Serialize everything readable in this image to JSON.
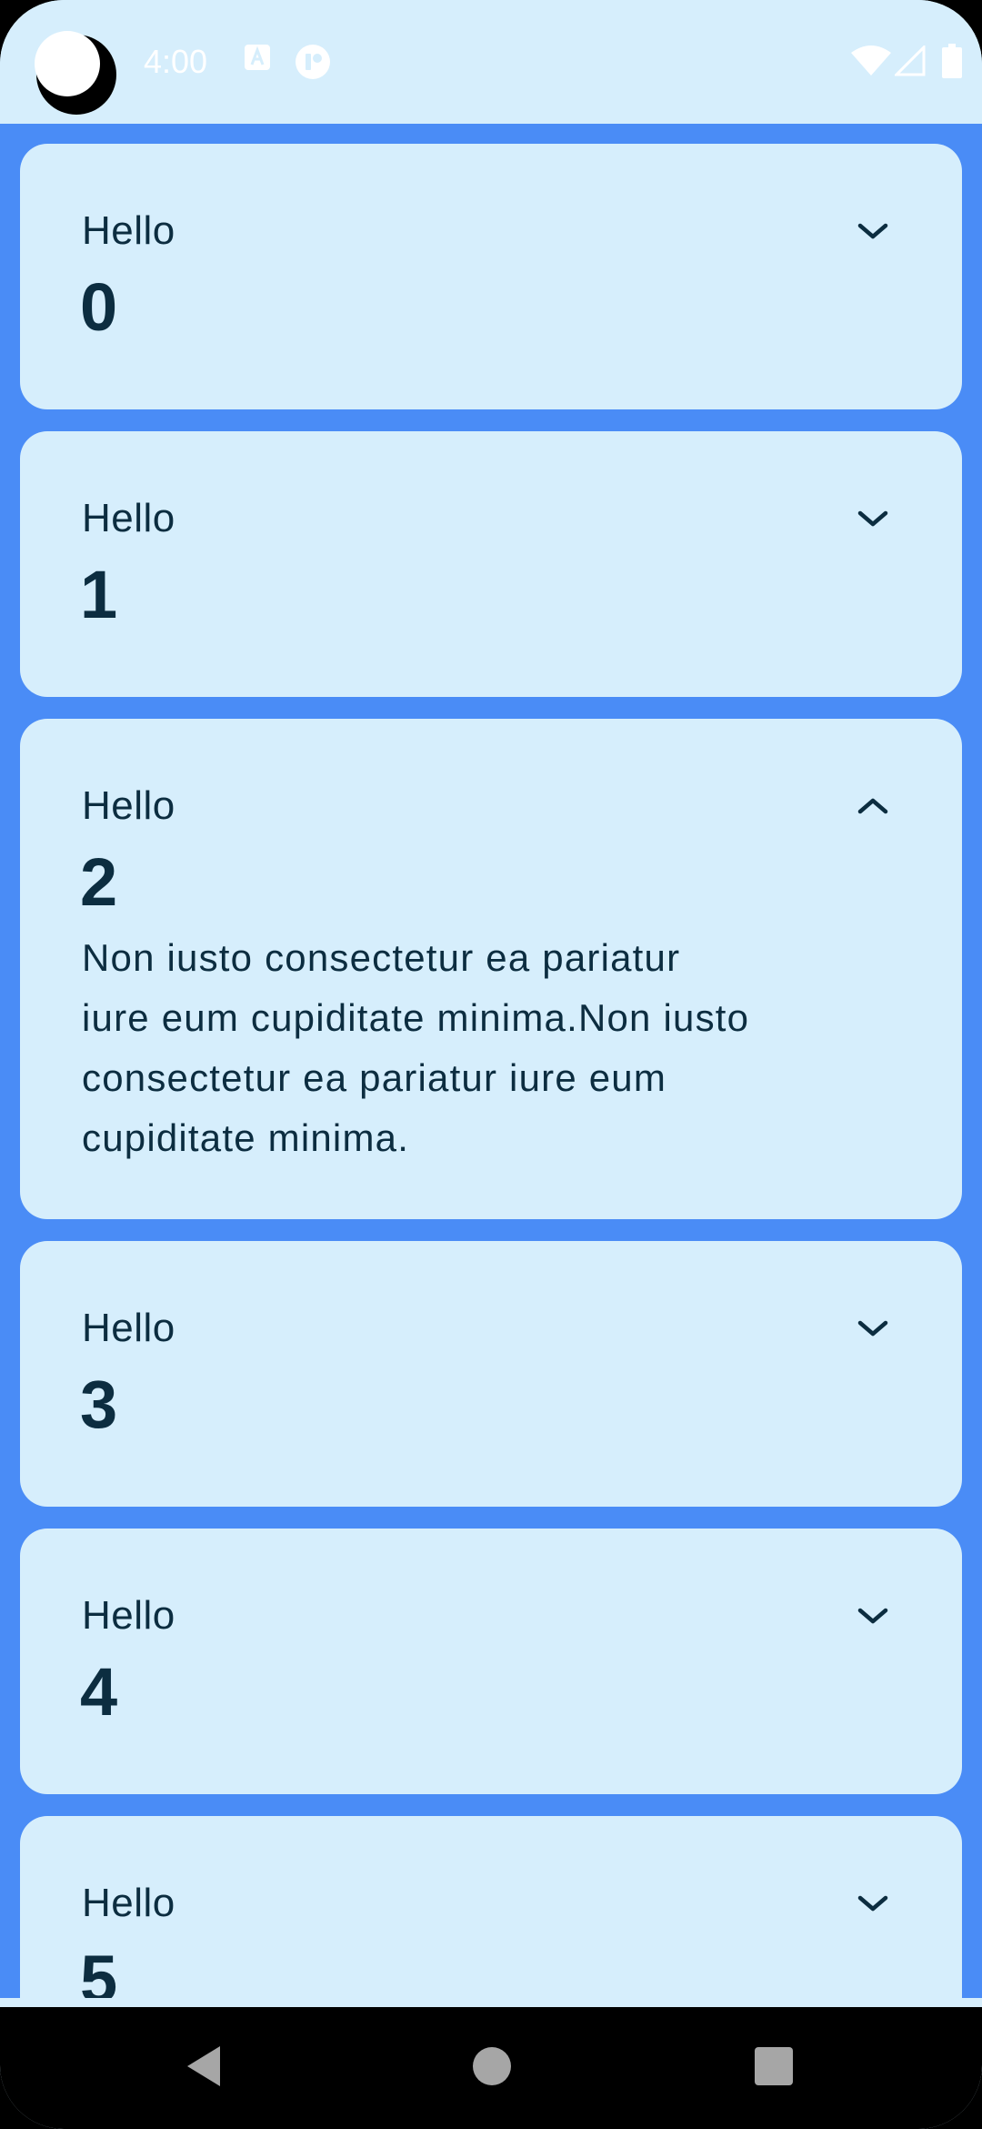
{
  "status_bar": {
    "time": "4:00",
    "icons": [
      "accessibility-a-icon",
      "record-icon",
      "wifi-icon",
      "signal-icon",
      "battery-icon"
    ]
  },
  "cards": [
    {
      "label": "Hello",
      "number": "0",
      "expanded": false,
      "body": ""
    },
    {
      "label": "Hello",
      "number": "1",
      "expanded": false,
      "body": ""
    },
    {
      "label": "Hello",
      "number": "2",
      "expanded": true,
      "body": "Non iusto consectetur ea pariatur iure eum cupiditate minima.Non iusto consectetur ea pariatur iure eum cupiditate minima."
    },
    {
      "label": "Hello",
      "number": "3",
      "expanded": false,
      "body": ""
    },
    {
      "label": "Hello",
      "number": "4",
      "expanded": false,
      "body": ""
    },
    {
      "label": "Hello",
      "number": "5",
      "expanded": false,
      "body": ""
    }
  ],
  "nav_bar": {
    "buttons": [
      "back-icon",
      "home-icon",
      "recents-icon"
    ]
  },
  "colors": {
    "background": "#4a8cf6",
    "card": "#d6eefc",
    "text": "#0c2d40",
    "status_bar": "#d6eefc",
    "nav_bar": "#000000"
  }
}
